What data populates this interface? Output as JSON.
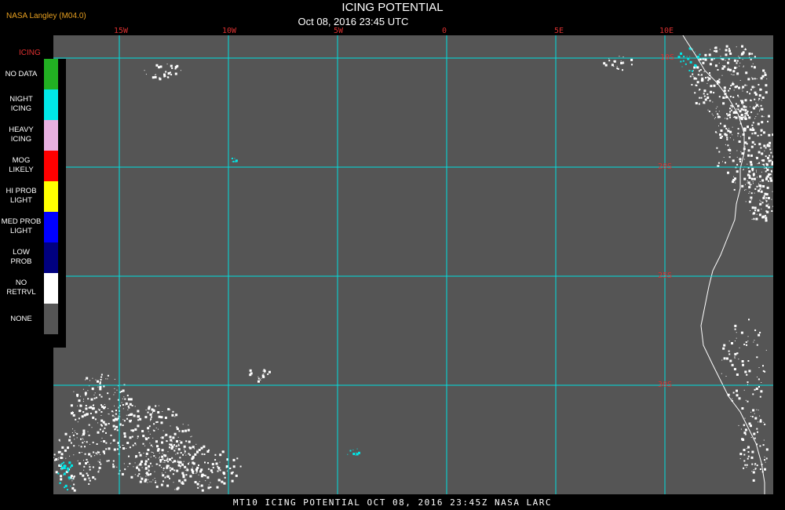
{
  "header": {
    "credit": "NASA Langley (M04.0)",
    "title": "ICING POTENTIAL",
    "subtitle": "Oct 08, 2016 23:45 UTC"
  },
  "lon_labels": [
    "15W",
    "10W",
    "5W",
    "0",
    "5E",
    "10E"
  ],
  "lat_labels": [
    "10S",
    "20S",
    "25S",
    "30S"
  ],
  "legend": {
    "title": "ICING",
    "items": [
      {
        "label": [
          "NO DATA"
        ],
        "color": "#22b022"
      },
      {
        "label": [
          "NIGHT",
          "ICING"
        ],
        "color": "#00e8e8"
      },
      {
        "label": [
          "HEAVY",
          "ICING"
        ],
        "color": "#e8b0e0"
      },
      {
        "label": [
          "MOG",
          "LIKELY"
        ],
        "color": "#ff0000"
      },
      {
        "label": [
          "HI PROB",
          "LIGHT"
        ],
        "color": "#ffff00"
      },
      {
        "label": [
          "MED PROB",
          "LIGHT"
        ],
        "color": "#0000ff"
      },
      {
        "label": [
          "LOW",
          "PROB"
        ],
        "color": "#000080"
      },
      {
        "label": [
          "NO",
          "RETRVL"
        ],
        "color": "#ffffff"
      },
      {
        "label": [
          "NONE"
        ],
        "color": "#555555"
      }
    ]
  },
  "footer": "MT10  ICING POTENTIAL  OCT 08, 2016 23:45Z  NASA LARC",
  "colors": {
    "background_field": "#555555",
    "gridlines": "#00e0e0",
    "coastline": "#ffffff",
    "labels": "#d83030"
  }
}
